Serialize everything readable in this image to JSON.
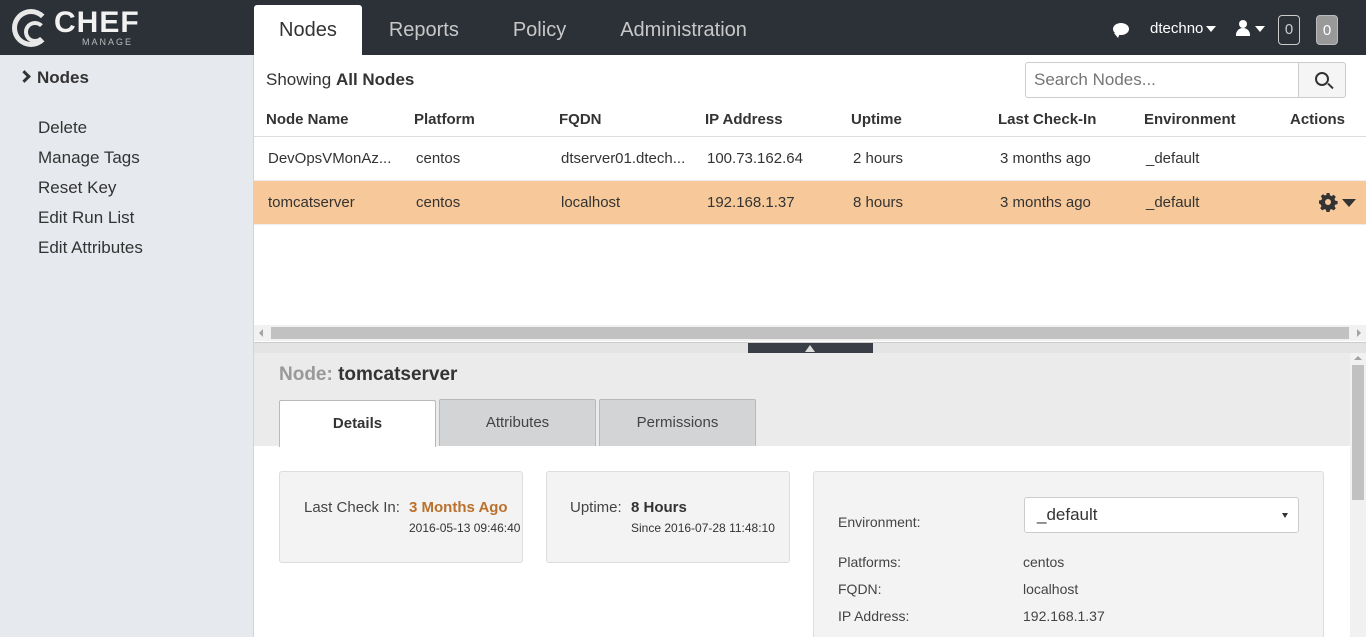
{
  "brand": {
    "name": "CHEF",
    "sub": "MANAGE"
  },
  "nav": {
    "tabs": [
      "Nodes",
      "Reports",
      "Policy",
      "Administration"
    ]
  },
  "user": {
    "name": "dtechno",
    "badge1": "0",
    "badge2": "0"
  },
  "sidebar": {
    "heading": "Nodes",
    "items": [
      "Delete",
      "Manage Tags",
      "Reset Key",
      "Edit Run List",
      "Edit Attributes"
    ]
  },
  "list": {
    "showing_prefix": "Showing",
    "showing_bold": "All Nodes",
    "search_placeholder": "Search Nodes...",
    "columns": [
      "Node Name",
      "Platform",
      "FQDN",
      "IP Address",
      "Uptime",
      "Last Check-In",
      "Environment",
      "Actions"
    ],
    "rows": [
      {
        "name": "DevOpsVMonAz...",
        "platform": "centos",
        "fqdn": "dtserver01.dtech...",
        "ip": "100.73.162.64",
        "uptime": "2 hours",
        "checkin": "3 months ago",
        "env": "_default"
      },
      {
        "name": "tomcatserver",
        "platform": "centos",
        "fqdn": "localhost",
        "ip": "192.168.1.37",
        "uptime": "8 hours",
        "checkin": "3 months ago",
        "env": "_default"
      }
    ]
  },
  "detail": {
    "label": "Node:",
    "name": "tomcatserver",
    "tabs": [
      "Details",
      "Attributes",
      "Permissions"
    ],
    "last_check_in_label": "Last Check In:",
    "last_check_in_value": "3 Months Ago",
    "last_check_in_time": "2016-05-13 09:46:40",
    "uptime_label": "Uptime:",
    "uptime_value": "8 Hours",
    "uptime_since": "Since 2016-07-28 11:48:10",
    "environment_label": "Environment:",
    "environment_value": "_default",
    "platforms_label": "Platforms:",
    "platforms_value": "centos",
    "fqdn_label": "FQDN:",
    "fqdn_value": "localhost",
    "ip_label": "IP Address:",
    "ip_value": "192.168.1.37"
  },
  "colors": {
    "topbar": "#2c3138",
    "selected_row": "#f7c99a",
    "sidebar": "#e6e9ee",
    "accent_orange": "#b9712d"
  },
  "icons": [
    "chef-logo-icon",
    "chat-icon",
    "user-icon",
    "search-icon",
    "gear-icon",
    "chevron-right-icon",
    "caret-down-icon"
  ]
}
